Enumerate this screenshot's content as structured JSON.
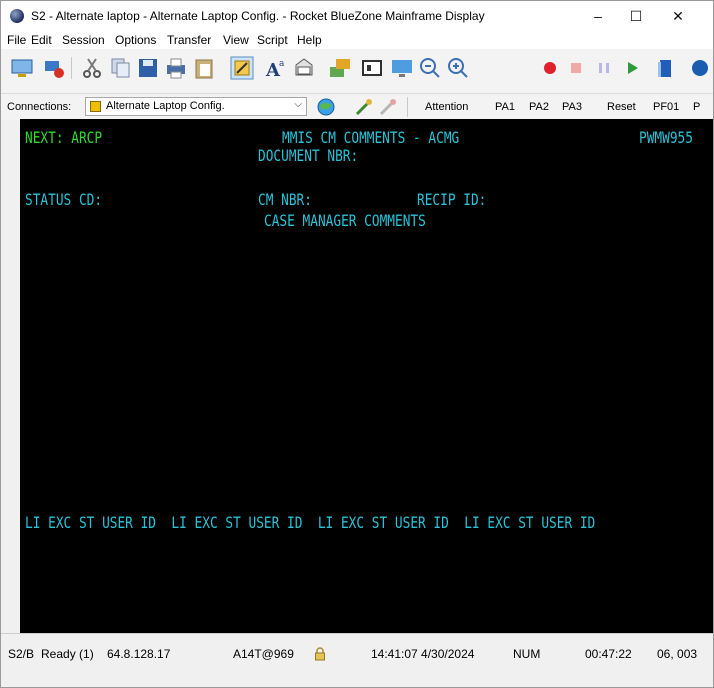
{
  "window": {
    "title": "S2 - Alternate laptop - Alternate Laptop Config. - Rocket BlueZone Mainframe Display",
    "minimize": "–",
    "maximize": "☐",
    "close": "✕"
  },
  "menu": [
    "File",
    "Edit",
    "Session",
    "Options",
    "Transfer",
    "View",
    "Script",
    "Help"
  ],
  "connections": {
    "label": "Connections:",
    "selected": "Alternate Laptop Config.",
    "buttons": [
      "Attention",
      "PA1",
      "PA2",
      "PA3",
      "Reset",
      "PF01",
      "P"
    ]
  },
  "terminal": {
    "next": "NEXT: ARCP",
    "screen_title": "MMIS CM COMMENTS - ACMG",
    "screen_id": "PWMW955",
    "document_nbr": "DOCUMENT NBR:",
    "status_cd": "STATUS CD:",
    "cm_nbr": "CM NBR:",
    "recip_id": "RECIP ID:",
    "case_manager_comments": "CASE MANAGER COMMENTS",
    "column_headers": "LI EXC ST USER ID  LI EXC ST USER ID  LI EXC ST USER ID  LI EXC ST USER ID"
  },
  "status_bar": {
    "session": "S2/B",
    "ready": "Ready (1)",
    "host": "64.8.128.17",
    "device": "A14T@969",
    "datetime": "14:41:07 4/30/2024",
    "num": "NUM",
    "elapsed": "00:47:22",
    "cursor": "06, 003"
  },
  "colors": {
    "terminal_bg": "#000000",
    "terminal_cyan": "#29c3d8",
    "terminal_green": "#2ddc2d"
  }
}
